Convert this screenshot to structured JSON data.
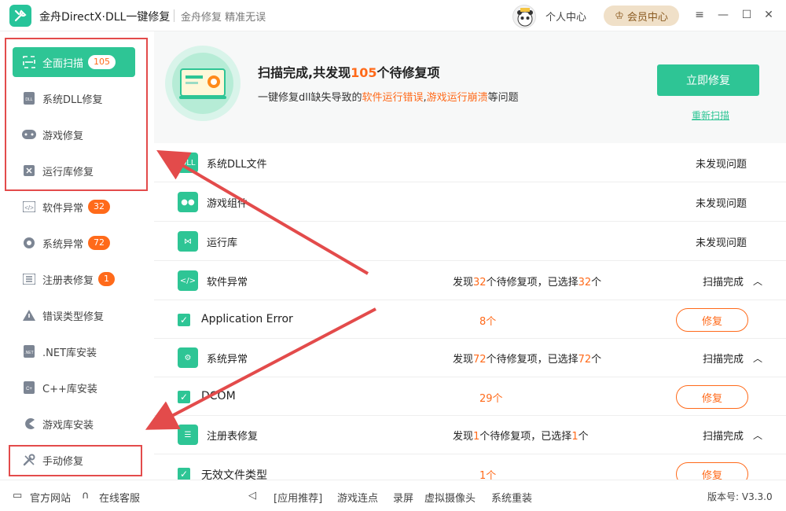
{
  "titlebar": {
    "app_title": "金舟DirectX·DLL一键修复",
    "slogan": "金舟修复 精准无误",
    "user_center": "个人中心",
    "vip": "会员中心"
  },
  "sidebar": {
    "items": [
      {
        "label": "全面扫描",
        "badge": "105",
        "icon": "scan-icon"
      },
      {
        "label": "系统DLL修复",
        "icon": "dll-icon"
      },
      {
        "label": "游戏修复",
        "icon": "gamepad-icon"
      },
      {
        "label": "运行库修复",
        "icon": "runtime-icon"
      },
      {
        "label": "软件异常",
        "badge": "32",
        "icon": "code-icon"
      },
      {
        "label": "系统异常",
        "badge": "72",
        "icon": "gear-icon"
      },
      {
        "label": "注册表修复",
        "badge": "1",
        "icon": "list-icon"
      },
      {
        "label": "错误类型修复",
        "icon": "warning-icon"
      },
      {
        "label": ".NET库安装",
        "icon": "net-icon"
      },
      {
        "label": "C++库安装",
        "icon": "cpp-icon"
      },
      {
        "label": "游戏库安装",
        "icon": "pacman-icon"
      },
      {
        "label": "手动修复",
        "icon": "wrench-icon"
      }
    ]
  },
  "hero": {
    "title_pre": "扫描完成,共发现",
    "title_num": "105",
    "title_post": "个待修复项",
    "sub_pre": "一键修复dll缺失导致的",
    "sub_hl1": "软件运行错误",
    "sub_sep": ",",
    "sub_hl2": "游戏运行崩溃",
    "sub_post": "等问题",
    "fix_now": "立即修复",
    "rescan": "重新扫描"
  },
  "results": {
    "rows": [
      {
        "label": "系统DLL文件",
        "status": "未发现问题"
      },
      {
        "label": "游戏组件",
        "status": "未发现问题"
      },
      {
        "label": "运行库",
        "status": "未发现问题"
      }
    ],
    "groups": [
      {
        "label": "软件异常",
        "found_pre": "发现",
        "found_num": "32",
        "found_mid": "个待修复项，已选择",
        "sel_num": "32",
        "found_post": "个",
        "done": "扫描完成",
        "item": {
          "label": "Application Error",
          "count": "8个",
          "action": "修复"
        }
      },
      {
        "label": "系统异常",
        "found_pre": "发现",
        "found_num": "72",
        "found_mid": "个待修复项，已选择",
        "sel_num": "72",
        "found_post": "个",
        "done": "扫描完成",
        "item": {
          "label": "DCOM",
          "count": "29个",
          "action": "修复"
        }
      },
      {
        "label": "注册表修复",
        "found_pre": "发现",
        "found_num": "1",
        "found_mid": "个待修复项，已选择",
        "sel_num": "1",
        "found_post": "个",
        "done": "扫描完成",
        "item": {
          "label": "无效文件类型",
          "count": "1个",
          "action": "修复"
        }
      }
    ]
  },
  "footer": {
    "official_site": "官方网站",
    "online_service": "在线客服",
    "recommend": "[应用推荐]",
    "links": [
      "游戏连点",
      "录屏",
      "虚拟摄像头",
      "系统重装"
    ],
    "version": "版本号: V3.3.0"
  },
  "colors": {
    "accent": "#2ec595",
    "orange": "#ff6a1a",
    "annotation": "#e34b4b"
  }
}
